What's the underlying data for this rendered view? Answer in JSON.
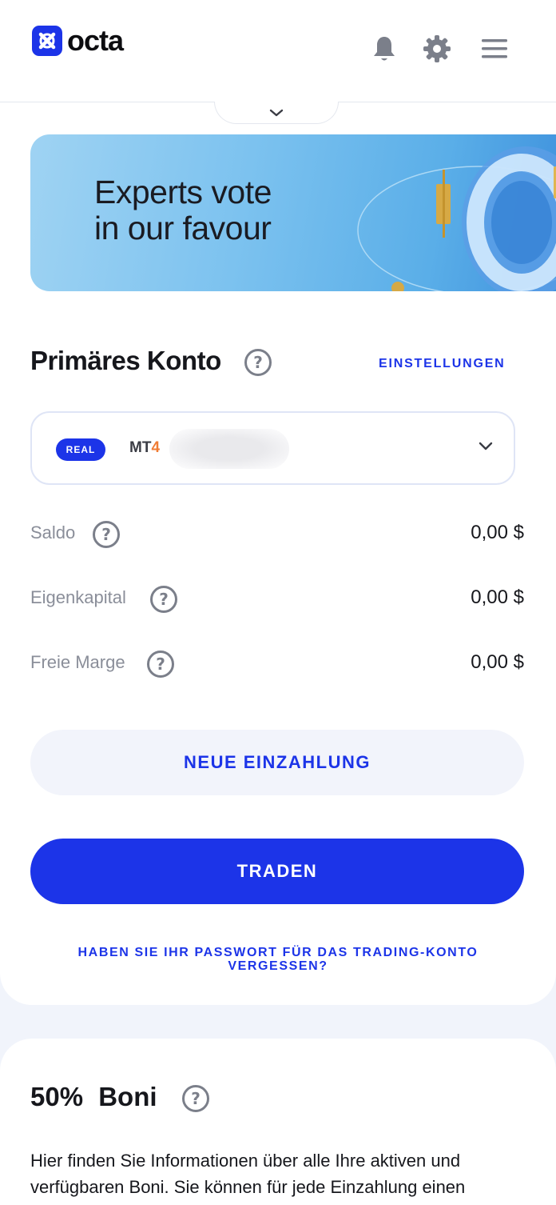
{
  "header": {
    "brand": "octa",
    "icons": [
      "bell-icon",
      "gear-icon",
      "menu-icon"
    ]
  },
  "banner": {
    "line1": "Experts vote",
    "line2": "in our favour"
  },
  "account": {
    "title": "Primäres Konto",
    "settings_label": "EINSTELLUNGEN",
    "badge": "REAL",
    "platform_prefix": "MT",
    "platform_suffix": "4",
    "metrics": [
      {
        "label": "Saldo",
        "value": "0,00 $"
      },
      {
        "label": "Eigenkapital",
        "value": "0,00 $"
      },
      {
        "label": "Freie Marge",
        "value": "0,00 $"
      }
    ],
    "deposit_label": "NEUE EINZAHLUNG",
    "trade_label": "TRADEN",
    "forgot_line1": "HABEN SIE IHR PASSWORT FÜR DAS TRADING-KONTO",
    "forgot_line2": "VERGESSEN?"
  },
  "bonus": {
    "title": "50% Boni",
    "description": "Hier finden Sie Informationen über alle Ihre aktiven und verfügbaren Boni. Sie können für jede Einzahlung einen"
  },
  "colors": {
    "accent": "#1c34e8",
    "mt4_orange": "#f07c34",
    "page_bg": "#f1f4fb"
  }
}
